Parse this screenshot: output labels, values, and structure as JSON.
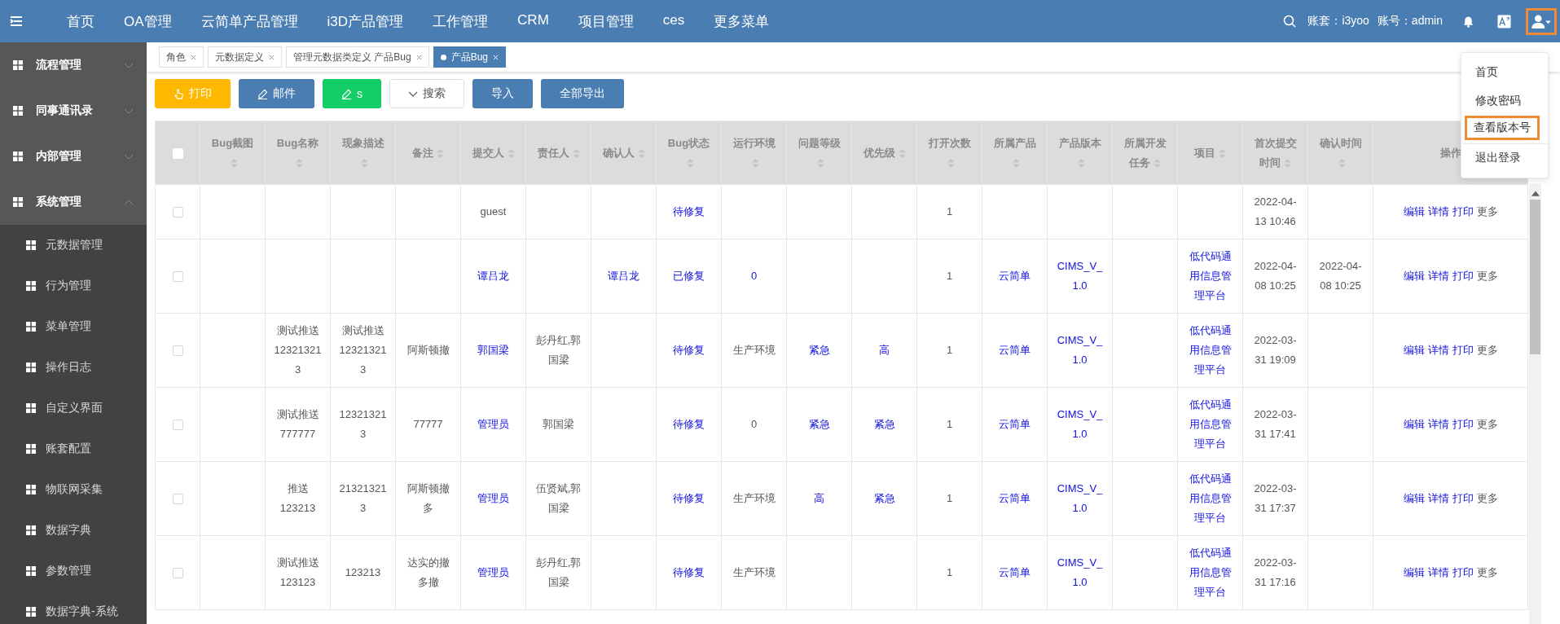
{
  "top_bar": {
    "nav_items": [
      "首页",
      "OA管理",
      "云简单产品管理",
      "i3D产品管理",
      "工作管理",
      "CRM",
      "项目管理",
      "ces",
      "更多菜单"
    ],
    "account_set": "账套：i3yoo",
    "account": "账号：admin",
    "user_menu": {
      "highlighted": true,
      "items": [
        {
          "label": "首页",
          "highlighted": false,
          "divider_before": false
        },
        {
          "label": "修改密码",
          "highlighted": false,
          "divider_before": false
        },
        {
          "label": "查看版本号",
          "highlighted": true,
          "divider_before": false
        },
        {
          "label": "退出登录",
          "highlighted": false,
          "divider_before": true
        }
      ]
    }
  },
  "sidebar": {
    "items": [
      {
        "label": "流程管理",
        "expanded": false
      },
      {
        "label": "同事通讯录",
        "expanded": false
      },
      {
        "label": "内部管理",
        "expanded": false
      },
      {
        "label": "系统管理",
        "expanded": true,
        "children": [
          {
            "label": "元数据管理"
          },
          {
            "label": "行为管理"
          },
          {
            "label": "菜单管理"
          },
          {
            "label": "操作日志"
          },
          {
            "label": "自定义界面"
          },
          {
            "label": "账套配置"
          },
          {
            "label": "物联网采集"
          },
          {
            "label": "数据字典"
          },
          {
            "label": "参数管理"
          },
          {
            "label": "数据字典-系统"
          }
        ]
      }
    ]
  },
  "tabs": [
    {
      "label": "角色",
      "selected": false
    },
    {
      "label": "元数据定义",
      "selected": false
    },
    {
      "label": "管理元数据类定义 产品Bug",
      "selected": false
    },
    {
      "label": "产品Bug",
      "selected": true
    }
  ],
  "toolbar": [
    {
      "label": "打印",
      "kind": "warning"
    },
    {
      "label": "邮件",
      "kind": "primary"
    },
    {
      "label": "s",
      "kind": "success"
    },
    {
      "label": "搜索",
      "kind": "default"
    },
    {
      "label": "导入",
      "kind": "primary"
    },
    {
      "label": "全部导出",
      "kind": "primary"
    }
  ],
  "table": {
    "header_checked": false,
    "columns": [
      {
        "label": "Bug截图",
        "sortable": true
      },
      {
        "label": "Bug名称",
        "sortable": true
      },
      {
        "label": "现象描述",
        "sortable": true
      },
      {
        "label": "备注",
        "sortable": true
      },
      {
        "label": "提交人",
        "sortable": true
      },
      {
        "label": "责任人",
        "sortable": true
      },
      {
        "label": "确认人",
        "sortable": true
      },
      {
        "label": "Bug状态",
        "sortable": true
      },
      {
        "label": "运行环境",
        "sortable": true
      },
      {
        "label": "问题等级",
        "sortable": true
      },
      {
        "label": "优先级",
        "sortable": true
      },
      {
        "label": "打开次数",
        "sortable": true
      },
      {
        "label": "所属产品",
        "sortable": true
      },
      {
        "label": "产品版本",
        "sortable": true
      },
      {
        "label": "所属开发任务",
        "sortable": true
      },
      {
        "label": "项目",
        "sortable": true
      },
      {
        "label": "首次提交时间",
        "sortable": true
      },
      {
        "label": "确认时间",
        "sortable": true
      },
      {
        "label": "操作",
        "sortable": false
      }
    ],
    "rows": [
      {
        "checked": false,
        "cells": [
          null,
          null,
          null,
          null,
          {
            "text": "guest",
            "kind": "text"
          },
          null,
          null,
          {
            "text": "待修复",
            "kind": "link"
          },
          null,
          null,
          null,
          {
            "text": "1",
            "kind": "text"
          },
          null,
          null,
          null,
          null,
          {
            "text": "2022-04-13 10:46",
            "kind": "text"
          },
          null
        ],
        "actions": [
          {
            "text": "编辑",
            "kind": "link"
          },
          {
            "text": "详情",
            "kind": "link"
          },
          {
            "text": "打印",
            "kind": "link"
          },
          {
            "text": "更多",
            "kind": "text"
          }
        ]
      },
      {
        "checked": false,
        "cells": [
          null,
          null,
          null,
          null,
          {
            "text": "谭吕龙",
            "kind": "link"
          },
          null,
          {
            "text": "谭吕龙",
            "kind": "link"
          },
          {
            "text": "已修复",
            "kind": "link"
          },
          {
            "text": "0",
            "kind": "link"
          },
          null,
          null,
          {
            "text": "1",
            "kind": "text"
          },
          {
            "text": "云简单",
            "kind": "link"
          },
          {
            "text": "CIMS_V_1.0",
            "kind": "link"
          },
          null,
          {
            "text": "低代码通用信息管理平台",
            "kind": "link"
          },
          {
            "text": "2022-04-08 10:25",
            "kind": "text"
          },
          {
            "text": "2022-04-08 10:25",
            "kind": "text"
          }
        ],
        "actions": [
          {
            "text": "编辑",
            "kind": "link"
          },
          {
            "text": "详情",
            "kind": "link"
          },
          {
            "text": "打印",
            "kind": "link"
          },
          {
            "text": "更多",
            "kind": "text"
          }
        ]
      },
      {
        "checked": false,
        "cells": [
          null,
          {
            "text": "测试推送123213213",
            "kind": "text"
          },
          {
            "text": "测试推送123213213",
            "kind": "text"
          },
          {
            "text": "阿斯顿撤",
            "kind": "text"
          },
          {
            "text": "郭国梁",
            "kind": "link"
          },
          {
            "text": "彭丹红,郭国梁",
            "kind": "text"
          },
          null,
          {
            "text": "待修复",
            "kind": "link"
          },
          {
            "text": "生产环境",
            "kind": "text"
          },
          {
            "text": "紧急",
            "kind": "link"
          },
          {
            "text": "高",
            "kind": "link"
          },
          {
            "text": "1",
            "kind": "text"
          },
          {
            "text": "云简单",
            "kind": "link"
          },
          {
            "text": "CIMS_V_1.0",
            "kind": "link"
          },
          null,
          {
            "text": "低代码通用信息管理平台",
            "kind": "link"
          },
          {
            "text": "2022-03-31 19:09",
            "kind": "text"
          },
          null
        ],
        "actions": [
          {
            "text": "编辑",
            "kind": "link"
          },
          {
            "text": "详情",
            "kind": "link"
          },
          {
            "text": "打印",
            "kind": "link"
          },
          {
            "text": "更多",
            "kind": "text"
          }
        ]
      },
      {
        "checked": false,
        "cells": [
          null,
          {
            "text": "测试推送777777",
            "kind": "text"
          },
          {
            "text": "123213213",
            "kind": "text"
          },
          {
            "text": "77777",
            "kind": "text"
          },
          {
            "text": "管理员",
            "kind": "link"
          },
          {
            "text": "郭国梁",
            "kind": "text"
          },
          null,
          {
            "text": "待修复",
            "kind": "link"
          },
          {
            "text": "0",
            "kind": "text"
          },
          {
            "text": "紧急",
            "kind": "link"
          },
          {
            "text": "紧急",
            "kind": "link"
          },
          {
            "text": "1",
            "kind": "text"
          },
          {
            "text": "云简单",
            "kind": "link"
          },
          {
            "text": "CIMS_V_1.0",
            "kind": "link"
          },
          null,
          {
            "text": "低代码通用信息管理平台",
            "kind": "link"
          },
          {
            "text": "2022-03-31 17:41",
            "kind": "text"
          },
          null
        ],
        "actions": [
          {
            "text": "编辑",
            "kind": "link"
          },
          {
            "text": "详情",
            "kind": "link"
          },
          {
            "text": "打印",
            "kind": "link"
          },
          {
            "text": "更多",
            "kind": "text"
          }
        ]
      },
      {
        "checked": false,
        "cells": [
          null,
          {
            "text": "推送123213",
            "kind": "text"
          },
          {
            "text": "213213213",
            "kind": "text"
          },
          {
            "text": "阿斯顿撤多",
            "kind": "text"
          },
          {
            "text": "管理员",
            "kind": "link"
          },
          {
            "text": "伍贤斌,郭国梁",
            "kind": "text"
          },
          null,
          {
            "text": "待修复",
            "kind": "link"
          },
          {
            "text": "生产环境",
            "kind": "text"
          },
          {
            "text": "高",
            "kind": "link"
          },
          {
            "text": "紧急",
            "kind": "link"
          },
          {
            "text": "1",
            "kind": "text"
          },
          {
            "text": "云简单",
            "kind": "link"
          },
          {
            "text": "CIMS_V_1.0",
            "kind": "link"
          },
          null,
          {
            "text": "低代码通用信息管理平台",
            "kind": "link"
          },
          {
            "text": "2022-03-31 17:37",
            "kind": "text"
          },
          null
        ],
        "actions": [
          {
            "text": "编辑",
            "kind": "link"
          },
          {
            "text": "详情",
            "kind": "link"
          },
          {
            "text": "打印",
            "kind": "link"
          },
          {
            "text": "更多",
            "kind": "text"
          }
        ]
      },
      {
        "checked": false,
        "cells": [
          null,
          {
            "text": "测试推送123123",
            "kind": "text"
          },
          {
            "text": "123213",
            "kind": "text"
          },
          {
            "text": "达实的撤多撤",
            "kind": "text"
          },
          {
            "text": "管理员",
            "kind": "link"
          },
          {
            "text": "彭丹红,郭国梁",
            "kind": "text"
          },
          null,
          {
            "text": "待修复",
            "kind": "link"
          },
          {
            "text": "生产环境",
            "kind": "text"
          },
          null,
          null,
          {
            "text": "1",
            "kind": "text"
          },
          {
            "text": "云简单",
            "kind": "link"
          },
          {
            "text": "CIMS_V_1.0",
            "kind": "link"
          },
          null,
          {
            "text": "低代码通用信息管理平台",
            "kind": "link"
          },
          {
            "text": "2022-03-31 17:16",
            "kind": "text"
          },
          null
        ],
        "actions": [
          {
            "text": "编辑",
            "kind": "link"
          },
          {
            "text": "详情",
            "kind": "link"
          },
          {
            "text": "打印",
            "kind": "link"
          },
          {
            "text": "更多",
            "kind": "text"
          }
        ]
      }
    ]
  }
}
